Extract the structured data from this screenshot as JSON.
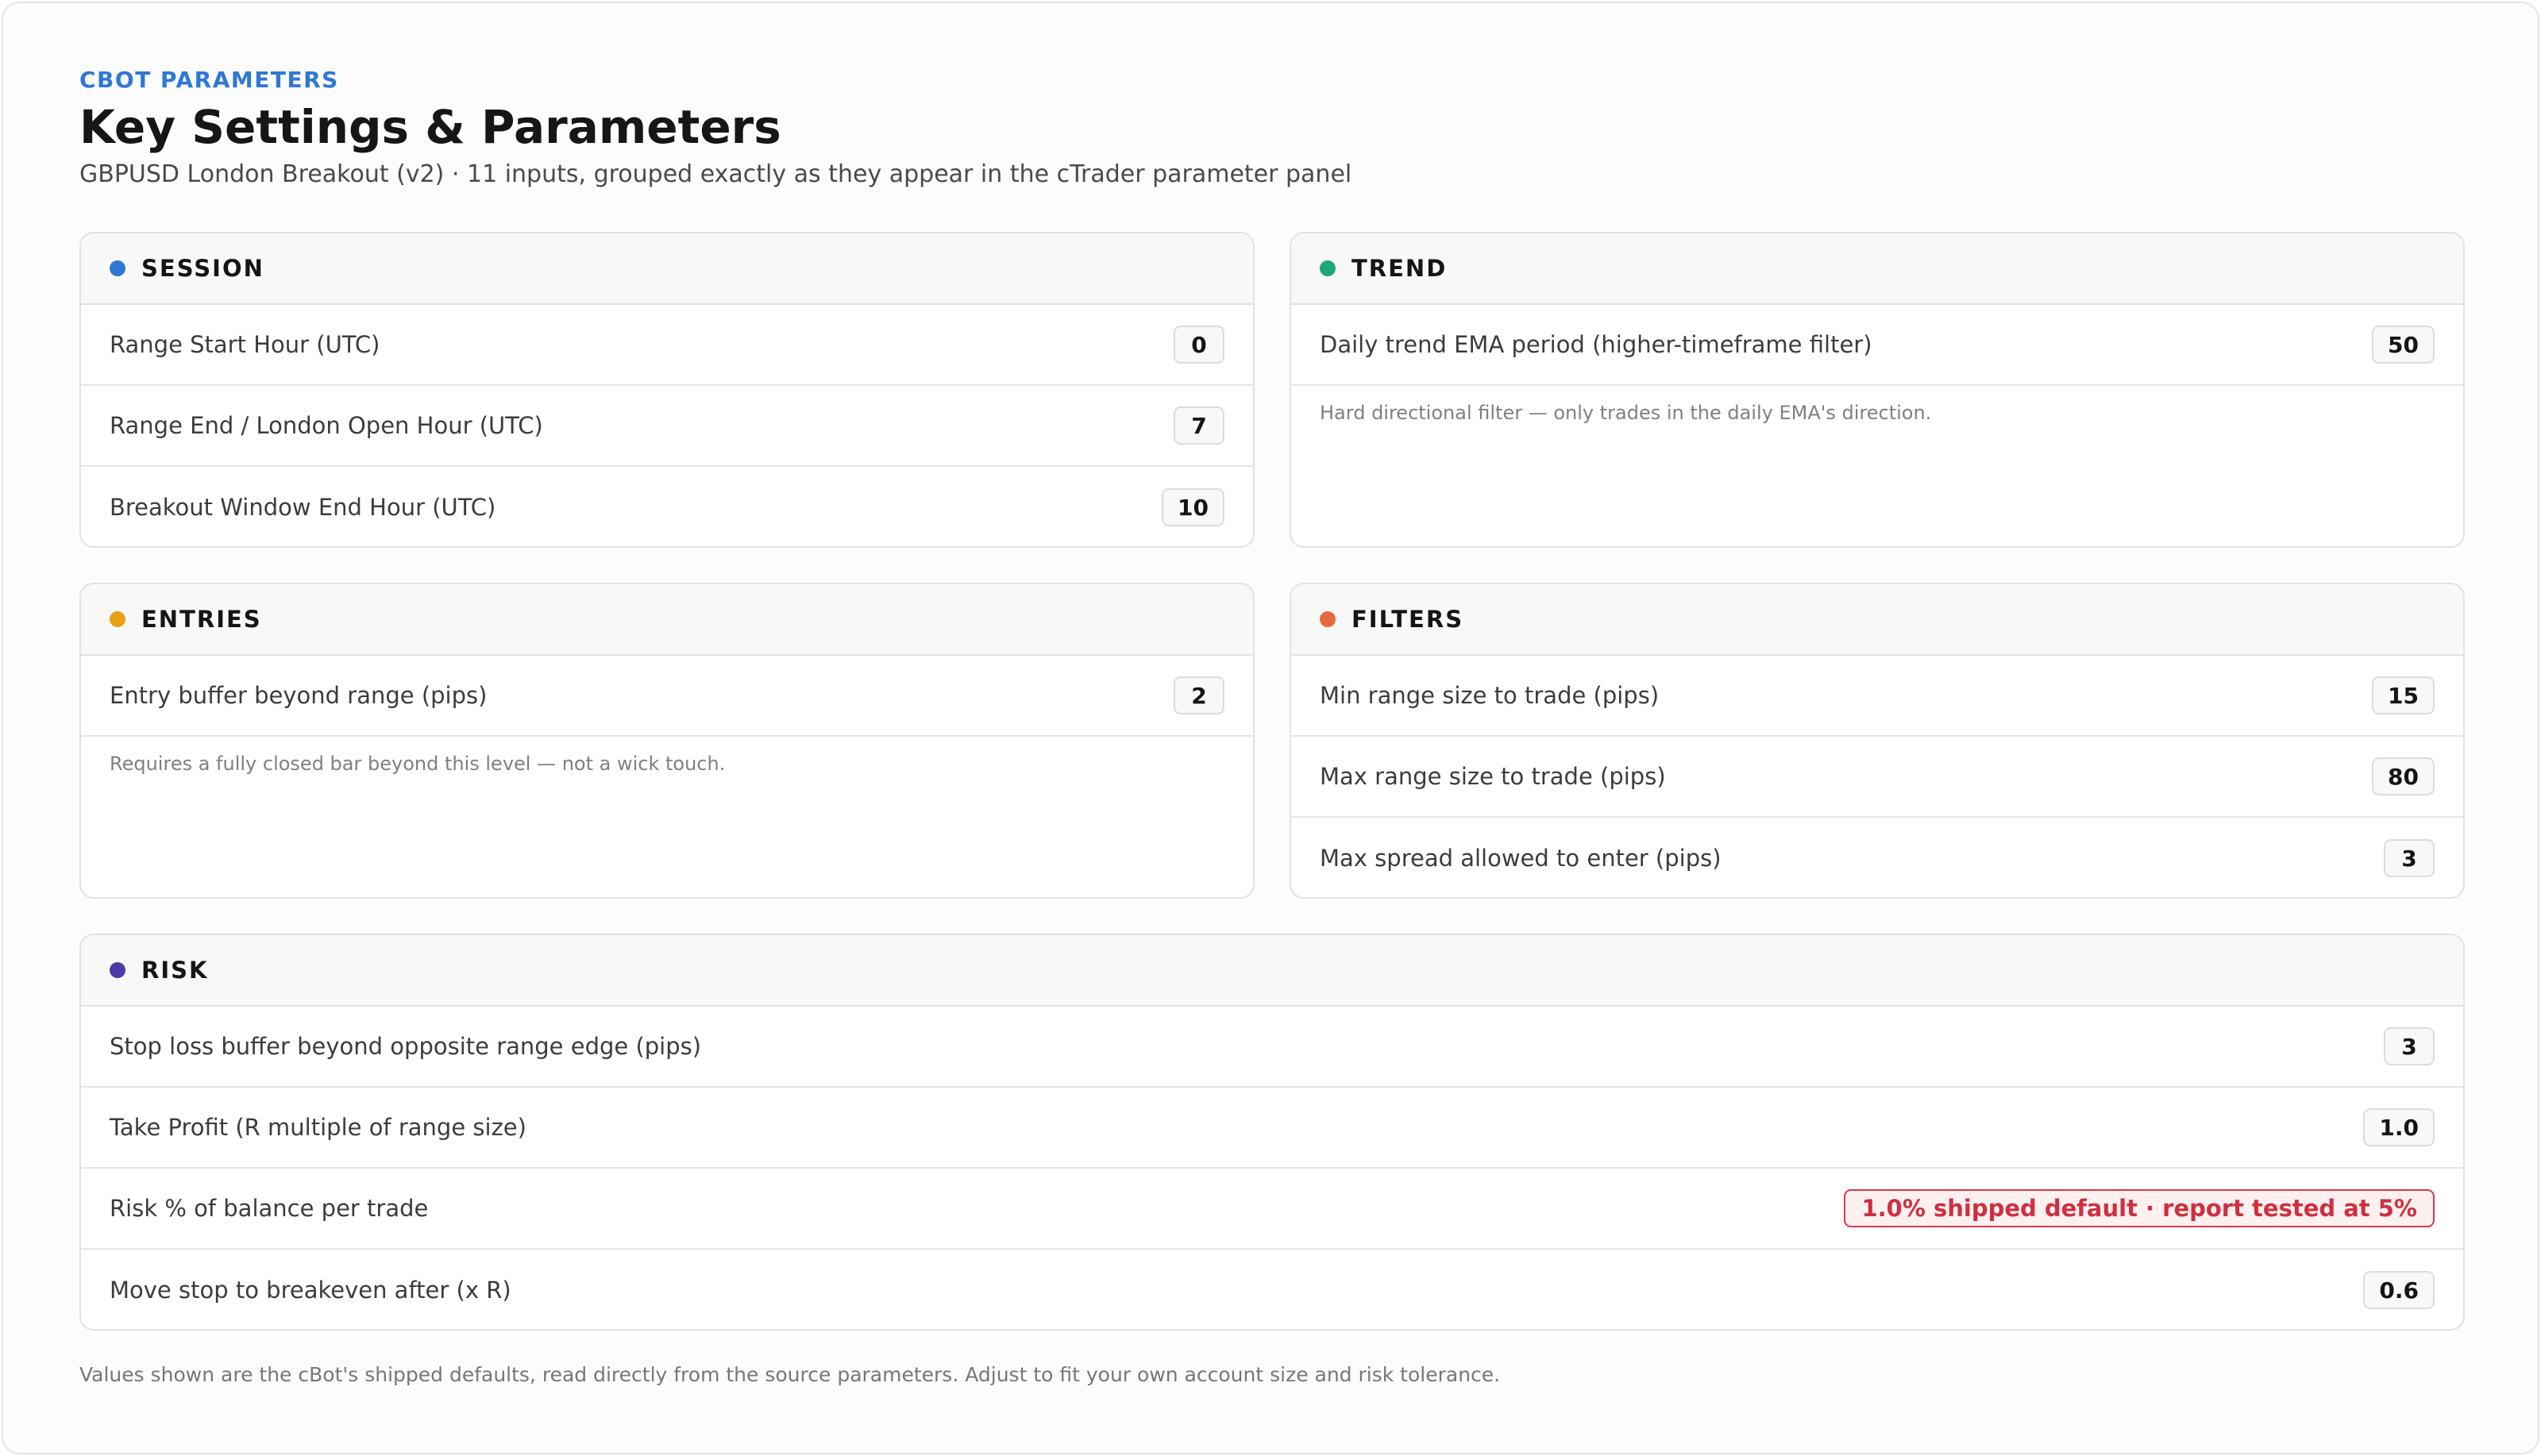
{
  "header": {
    "eyebrow": "CBOT PARAMETERS",
    "title": "Key Settings & Parameters",
    "subtitle": "GBPUSD London Breakout (v2) · 11 inputs, grouped exactly as they appear in the cTrader parameter panel"
  },
  "sections": {
    "session": {
      "title": "SESSION",
      "color": "#2f78d4",
      "rows": [
        {
          "label": "Range Start Hour (UTC)",
          "value": "0"
        },
        {
          "label": "Range End / London Open Hour (UTC)",
          "value": "7"
        },
        {
          "label": "Breakout Window End Hour (UTC)",
          "value": "10"
        }
      ]
    },
    "trend": {
      "title": "TREND",
      "color": "#1aa878",
      "rows": [
        {
          "label": "Daily trend EMA period (higher-timeframe filter)",
          "value": "50"
        }
      ],
      "note": "Hard directional filter — only trades in the daily EMA's direction."
    },
    "entries": {
      "title": "ENTRIES",
      "color": "#e9a012",
      "rows": [
        {
          "label": "Entry buffer beyond range (pips)",
          "value": "2"
        }
      ],
      "note": "Requires a fully closed bar beyond this level — not a wick touch."
    },
    "filters": {
      "title": "FILTERS",
      "color": "#e8683e",
      "rows": [
        {
          "label": "Min range size to trade (pips)",
          "value": "15"
        },
        {
          "label": "Max range size to trade (pips)",
          "value": "80"
        },
        {
          "label": "Max spread allowed to enter (pips)",
          "value": "3"
        }
      ]
    },
    "risk": {
      "title": "RISK",
      "color": "#4b3aa8",
      "rows": [
        {
          "label": "Stop loss buffer beyond opposite range edge (pips)",
          "value": "3"
        },
        {
          "label": "Take Profit (R multiple of range size)",
          "value": "1.0"
        },
        {
          "label": "Risk % of balance per trade",
          "value": "1.0% shipped default · report tested at 5%"
        },
        {
          "label": "Move stop to breakeven after (x R)",
          "value": "0.6"
        }
      ]
    }
  },
  "warning_color": "#cf2f3f",
  "footnote": "Values shown are the cBot's shipped defaults, read directly from the source parameters. Adjust to fit your own account size and risk tolerance."
}
